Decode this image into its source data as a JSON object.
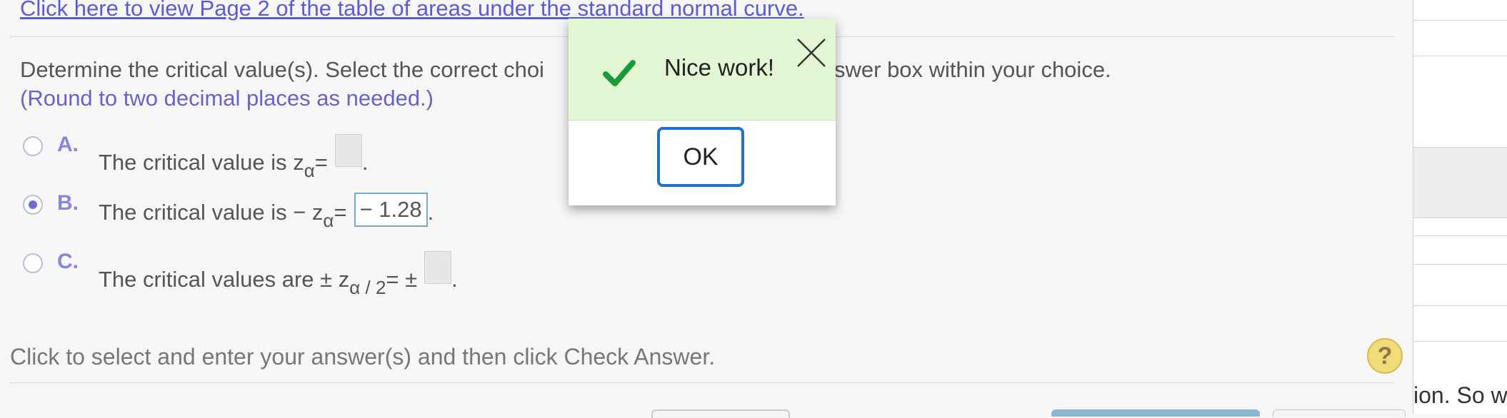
{
  "link_text": "Click here to view Page 2 of the table of areas under the standard normal curve.",
  "question": {
    "part1": "Determine the critical value(s). Select the correct choi",
    "part2": "swer box within your choice."
  },
  "hint": "(Round to two decimal places as needed.)",
  "options": [
    {
      "letter": "A.",
      "text": "The critical value is z",
      "subscript": "α",
      "suffix": " =",
      "value": "",
      "end": ".",
      "selected": false
    },
    {
      "letter": "B.",
      "text": "The critical value is  − z",
      "subscript": "α",
      "suffix": " =",
      "value": "− 1.28",
      "end": ".",
      "selected": true
    },
    {
      "letter": "C.",
      "text": "The critical values are  ± z",
      "subscript": "α / 2",
      "suffix": " = ±",
      "value": "",
      "end": ".",
      "selected": false
    }
  ],
  "instruction": "Click to select and enter your answer(s) and then click Check Answer.",
  "help_symbol": "?",
  "right_panel_text": "ion. So w",
  "popup": {
    "title": "Nice work!",
    "ok_label": "OK"
  },
  "icons": {
    "check": "checkmark-icon",
    "close": "close-icon",
    "help": "question-mark-icon"
  },
  "colors": {
    "link": "#5b5bd6",
    "hint": "#6a63c6",
    "popup_header": "#e2f6d3",
    "check": "#1a9a3a",
    "ok_border": "#1f73c5"
  }
}
